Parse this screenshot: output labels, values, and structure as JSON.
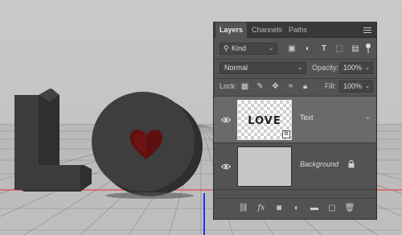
{
  "tabs": [
    "Layers",
    "Channels",
    "Paths"
  ],
  "filter": {
    "kind_label": "Kind"
  },
  "blend": {
    "mode": "Normal",
    "opacity_label": "Opacity:",
    "opacity_value": "100%"
  },
  "lock": {
    "label": "Lock:",
    "fill_label": "Fill:",
    "fill_value": "100%"
  },
  "layers": [
    {
      "name": "Text",
      "thumb_text": "LOVE",
      "selected": true
    },
    {
      "name": "Background",
      "locked": true
    }
  ],
  "colors": {
    "panel_bg": "#535353",
    "selected_layer": "#6a6a6a",
    "letter": "#3c3c3c",
    "heart": "#6b1212",
    "ground_line": "#e05a5a",
    "vertical_guide": "#1a35ff"
  }
}
